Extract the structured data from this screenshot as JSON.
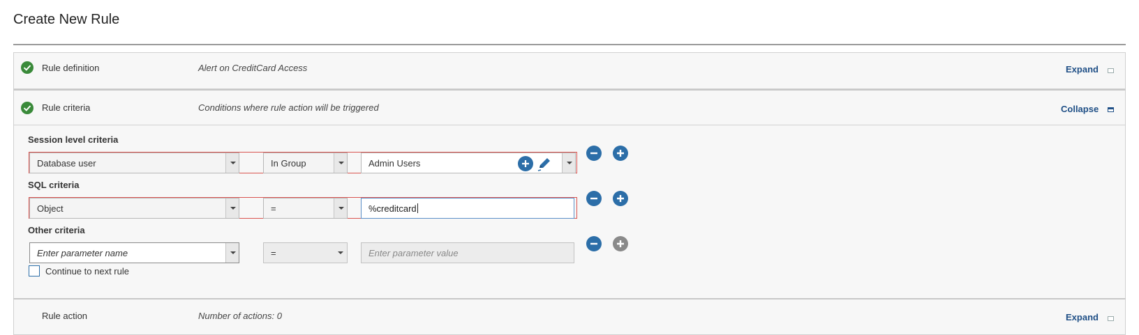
{
  "page": {
    "title": "Create New Rule"
  },
  "sections": {
    "definition": {
      "label": "Rule definition",
      "description": "Alert on CreditCard Access",
      "toggle": "Expand"
    },
    "criteria": {
      "label": "Rule criteria",
      "description": "Conditions where rule action will be triggered",
      "toggle": "Collapse"
    },
    "action": {
      "label": "Rule action",
      "description": "Number of actions: 0",
      "toggle": "Expand"
    }
  },
  "criteria": {
    "session": {
      "label": "Session level criteria",
      "field": "Database user",
      "operator": "In Group",
      "value": "Admin Users"
    },
    "sql": {
      "label": "SQL criteria",
      "field": "Object",
      "operator": "=",
      "value": "%creditcard"
    },
    "other": {
      "label": "Other criteria",
      "field_placeholder": "Enter parameter name",
      "operator": "=",
      "value_placeholder": "Enter parameter value"
    }
  },
  "continue_option": {
    "label": "Continue to next rule",
    "checked": false
  },
  "icons": {
    "check": "check-circle-icon",
    "remove": "minus-circle-icon",
    "add": "plus-circle-icon",
    "edit": "pencil-icon"
  },
  "colors": {
    "accent": "#2c6ea8",
    "error": "#d9534f",
    "success": "#3a8a3a",
    "link": "#1f4f86"
  }
}
